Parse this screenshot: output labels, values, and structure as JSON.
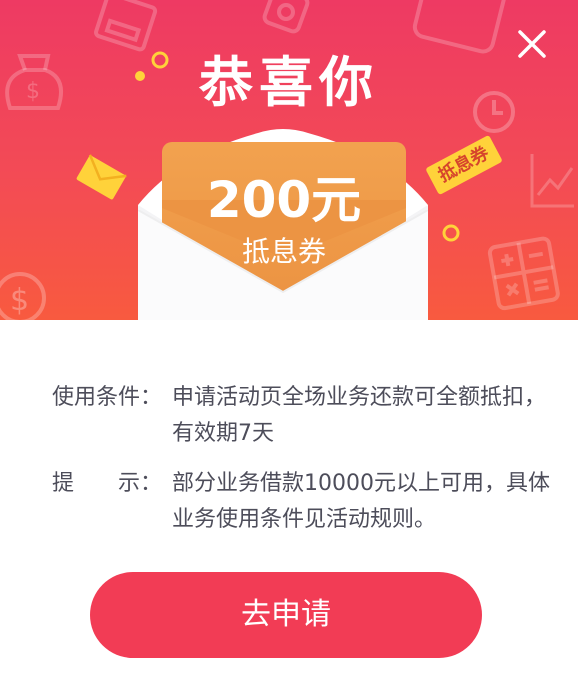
{
  "dialog": {
    "title": "恭喜你",
    "coupon": {
      "amount": "200元",
      "type": "抵息券"
    },
    "tag": "抵息券",
    "terms": [
      {
        "label": "使用条件：",
        "value": "申请活动页全场业务还款可全额抵扣，有效期7天"
      },
      {
        "label": "提　　示：",
        "value": "部分业务借款10000元以上可用，具体业务使用条件见活动规则。"
      }
    ],
    "button_label": "去申请"
  },
  "colors": {
    "banner_top": "#ee3a63",
    "banner_bottom": "#f85a3f",
    "coupon": "#ec9443",
    "tag": "#ffd23a",
    "button": "#f23c55",
    "text": "#4d4d5a"
  },
  "icons": [
    "close-icon",
    "atm-icon",
    "money-bag-icon",
    "coin-icon",
    "clock-icon",
    "calculator-icon",
    "envelope-icon",
    "dollar-coin-icon",
    "chart-icon"
  ]
}
